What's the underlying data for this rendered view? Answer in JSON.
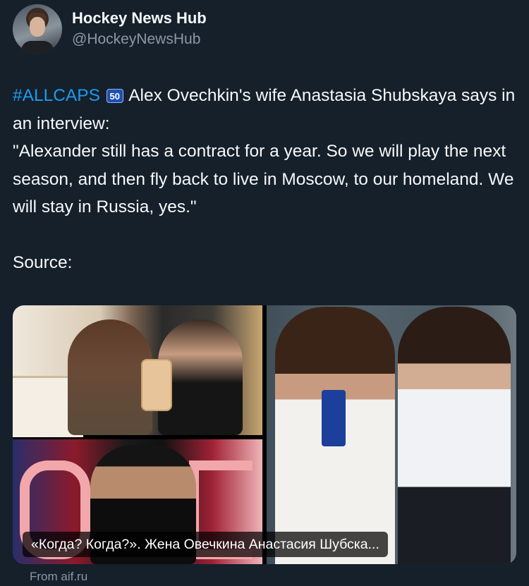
{
  "author": {
    "display_name": "Hockey News Hub",
    "handle": "@HockeyNewsHub"
  },
  "tweet": {
    "hashtag": "#ALLCAPS",
    "badge": "50",
    "line1_rest": "Alex Ovechkin's wife Anastasia Shubskaya says in an interview:",
    "quote": "\"Alexander still has a contract for a year. So we will play the next season, and then fly back to live in Moscow, to our homeland. We will stay in Russia, yes.\"",
    "source_label": "Source:"
  },
  "link_card": {
    "caption": "«Когда? Когда?». Жена Овечкина Анастасия Шубска...",
    "domain": "From aif.ru"
  },
  "colors": {
    "background": "#15202b",
    "hashtag": "#1d9bf0",
    "secondary_text": "#8b98a5"
  }
}
